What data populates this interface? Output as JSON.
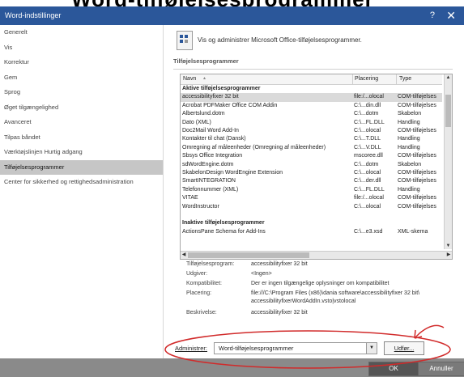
{
  "overlay_title": "Word-tilføjelsesprogrammer",
  "window": {
    "title": "Word-indstillinger",
    "help": "?",
    "close": "✕"
  },
  "sidebar": {
    "items": [
      "Generelt",
      "Vis",
      "Korrektur",
      "Gem",
      "Sprog",
      "Øget tilgængelighed",
      "Avanceret",
      "Tilpas båndet",
      "Værktøjslinjen Hurtig adgang",
      "Tilføjelsesprogrammer",
      "Center for sikkerhed og rettighedsadministration"
    ],
    "selected_index": 9
  },
  "main": {
    "header": "Vis og administrer Microsoft Office-tilføjelsesprogrammer.",
    "section": "Tilføjelsesprogrammer",
    "columns": [
      "Navn",
      "Placering",
      "Type"
    ],
    "rows": [
      {
        "name": "Aktive tilføjelsesprogrammer",
        "loc": "",
        "type": "",
        "group": true
      },
      {
        "name": "accessibilityfixer 32 bit",
        "loc": "file:/...olocal",
        "type": "COM-tilføjelses",
        "hl": true
      },
      {
        "name": "Acrobat PDFMaker Office COM Addin",
        "loc": "C:\\...din.dll",
        "type": "COM-tilføjelses"
      },
      {
        "name": "Albertslund.dotm",
        "loc": "C:\\...dotm",
        "type": "Skabelon"
      },
      {
        "name": "Dato (XML)",
        "loc": "C:\\...FL.DLL",
        "type": "Handling"
      },
      {
        "name": "Doc2Mail Word Add-In",
        "loc": "C:\\...olocal",
        "type": "COM-tilføjelses"
      },
      {
        "name": "Kontakter til chat (Dansk)",
        "loc": "C:\\...T.DLL",
        "type": "Handling"
      },
      {
        "name": "Omregning af måleenheder (Omregning af måleenheder)",
        "loc": "C:\\...V.DLL",
        "type": "Handling"
      },
      {
        "name": "Sbsys Office Integration",
        "loc": "mscoree.dll",
        "type": "COM-tilføjelses"
      },
      {
        "name": "sdWordEngine.dotm",
        "loc": "C:\\...dotm",
        "type": "Skabelon"
      },
      {
        "name": "SkabelonDesign WordEngine Extension",
        "loc": "C:\\...olocal",
        "type": "COM-tilføjelses"
      },
      {
        "name": "SmartINTEGRATION",
        "loc": "C:\\...der.dll",
        "type": "COM-tilføjelses"
      },
      {
        "name": "Telefonnummer (XML)",
        "loc": "C:\\...FL.DLL",
        "type": "Handling"
      },
      {
        "name": "VITAE",
        "loc": "file:/...olocal",
        "type": "COM-tilføjelses"
      },
      {
        "name": "WordInstructor",
        "loc": "C:\\...olocal",
        "type": "COM-tilføjelses"
      },
      {
        "name": "",
        "loc": "",
        "type": ""
      },
      {
        "name": "Inaktive tilføjelsesprogrammer",
        "loc": "",
        "type": "",
        "group": true
      },
      {
        "name": "ActionsPane Schema for Add-Ins",
        "loc": "C:\\...e3.xsd",
        "type": "XML-skema"
      }
    ],
    "details": {
      "addin_label": "Tilføjelsesprogram:",
      "addin_value": "accessibilityfixer 32 bit",
      "publisher_label": "Udgiver:",
      "publisher_value": "<Ingen>",
      "compat_label": "Kompatibilitet:",
      "compat_value": "Der er ingen tilgængelige oplysninger om kompatibilitet",
      "location_label": "Placering:",
      "location_value_1": "file:///C:\\Program Files (x86)\\dania software\\accessibilityfixer 32 bit\\",
      "location_value_2": "accessibilityfixerWordAddIn.vsto|vstolocal",
      "desc_label": "Beskrivelse:",
      "desc_value": "accessibilityfixer 32 bit"
    },
    "manage": {
      "label": "Administrer:",
      "value": "Word-tilføjelsesprogrammer",
      "go_label": "Udfør..."
    }
  },
  "footer": {
    "ok": "OK",
    "cancel": "Annuller"
  },
  "colors": {
    "titlebar": "#2b579a",
    "annotation": "#d12a2a",
    "selected": "#c6c6c6"
  }
}
